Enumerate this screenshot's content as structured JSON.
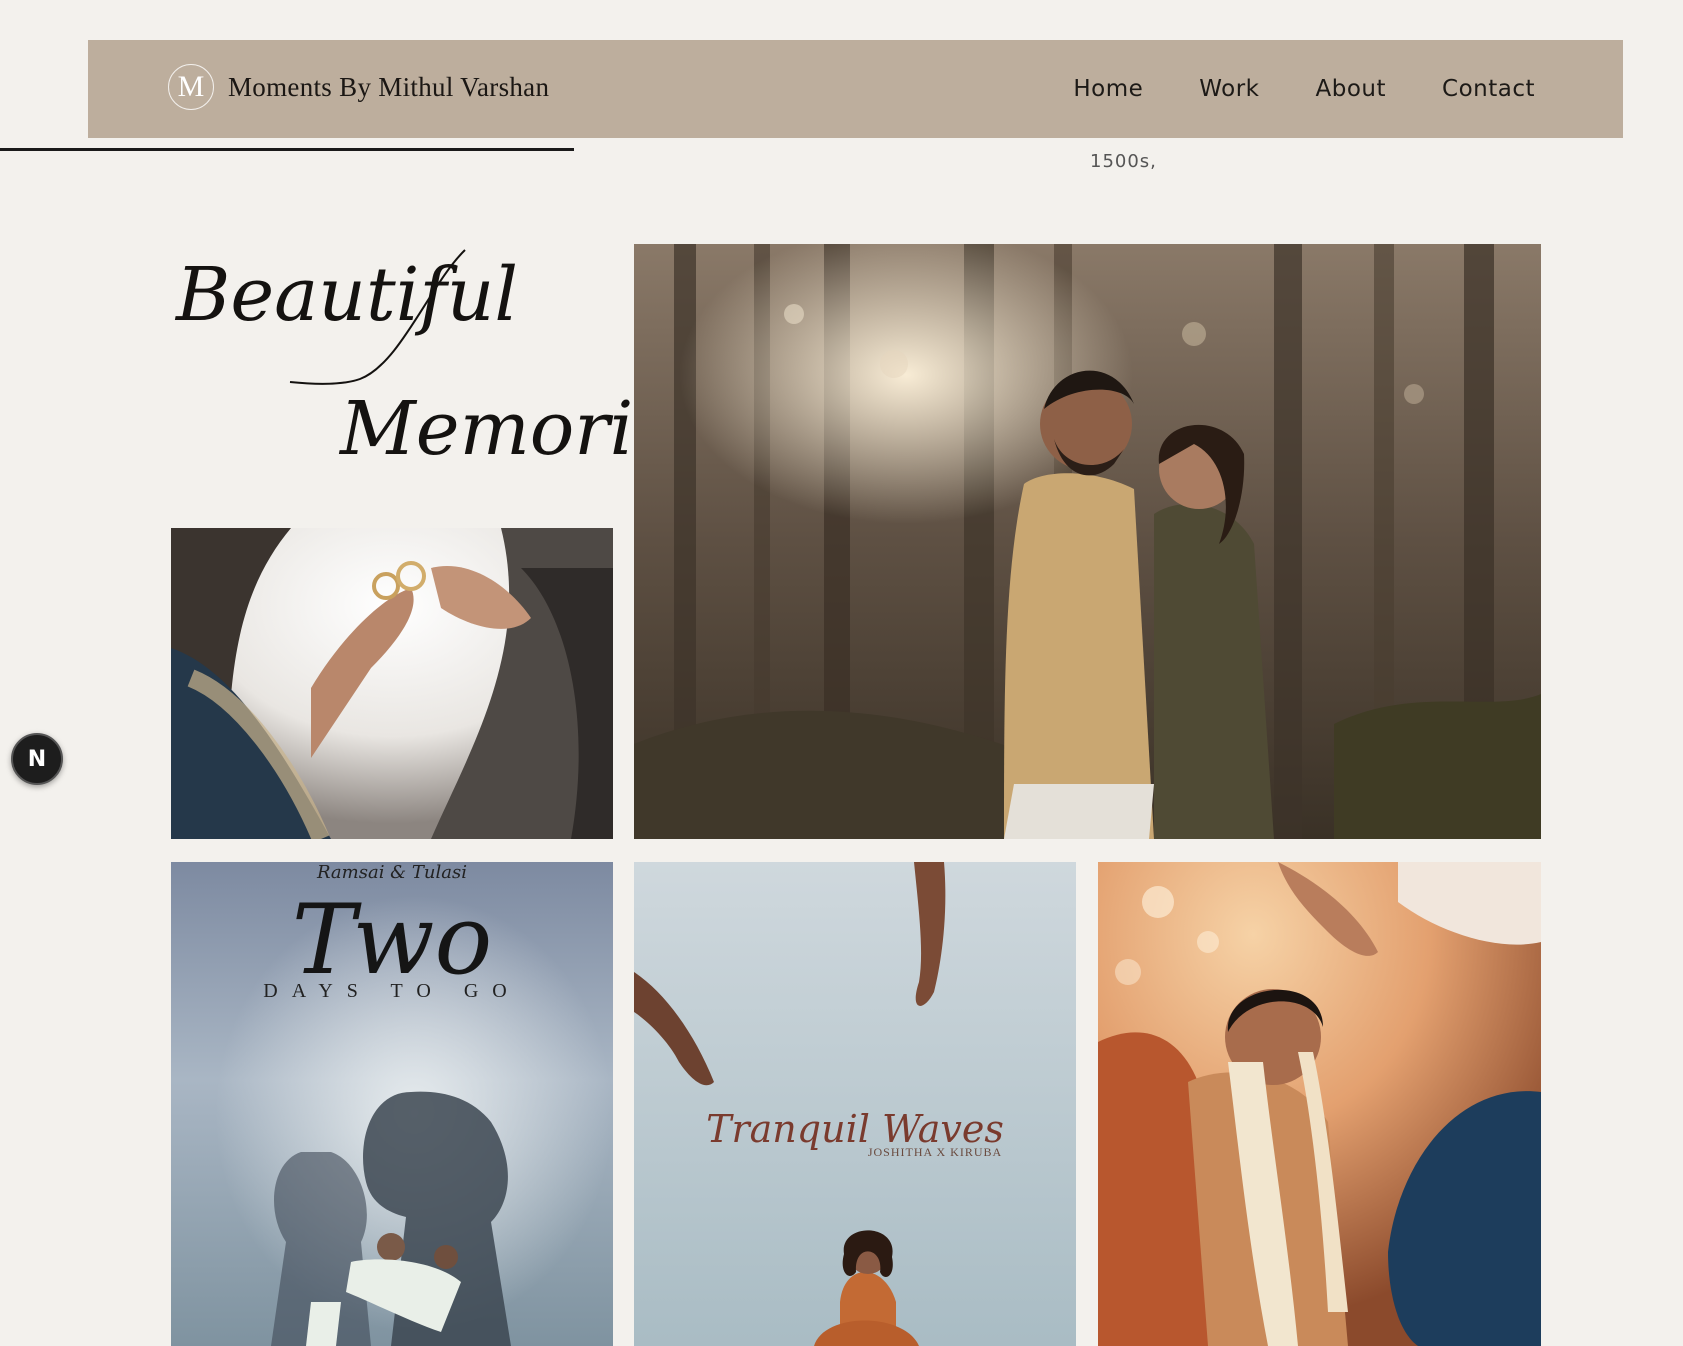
{
  "header": {
    "logo_letter": "M",
    "brand": "Moments By Mithul Varshan",
    "nav": [
      "Home",
      "Work",
      "About",
      "Contact"
    ]
  },
  "intro_fragment": "1500s,",
  "hero": {
    "line1": "Beautiful",
    "line2": "Memories"
  },
  "posters": {
    "ramsai": {
      "top": "Ramsai & Tulasi",
      "big": "Two",
      "days": "DAYS TO GO"
    },
    "tranquil": {
      "title": "Tranquil Waves",
      "sub": "JOSHITHA X KIRUBA"
    }
  },
  "badge": "N",
  "colors": {
    "background": "#f3f1ed",
    "header": "#bdae9d"
  }
}
